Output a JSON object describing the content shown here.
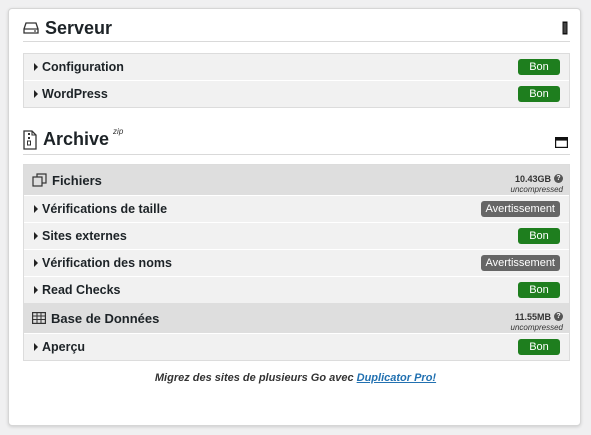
{
  "serveur": {
    "title": "Serveur",
    "rows": [
      {
        "label": "Configuration",
        "status": "Bon"
      },
      {
        "label": "WordPress",
        "status": "Bon"
      }
    ]
  },
  "archive": {
    "title": "Archive",
    "superscript": "zip",
    "fichiers": {
      "title": "Fichiers",
      "size": "10.43GB",
      "size_note": "uncompressed",
      "help": "?",
      "rows": [
        {
          "label": "Vérifications de taille",
          "status": "Avertissement"
        },
        {
          "label": "Sites externes",
          "status": "Bon"
        },
        {
          "label": "Vérification des noms",
          "status": "Avertissement"
        },
        {
          "label": "Read Checks",
          "status": "Bon"
        }
      ]
    },
    "database": {
      "title": "Base de Données",
      "size": "11.55MB",
      "size_note": "uncompressed",
      "help": "?",
      "rows": [
        {
          "label": "Aperçu",
          "status": "Bon"
        }
      ]
    }
  },
  "footer": {
    "text": "Migrez des sites de plusieurs Go avec ",
    "link": "Duplicator Pro!"
  },
  "colors": {
    "ok": "#1e7e1e",
    "warn": "#666666",
    "link": "#2271b1"
  }
}
